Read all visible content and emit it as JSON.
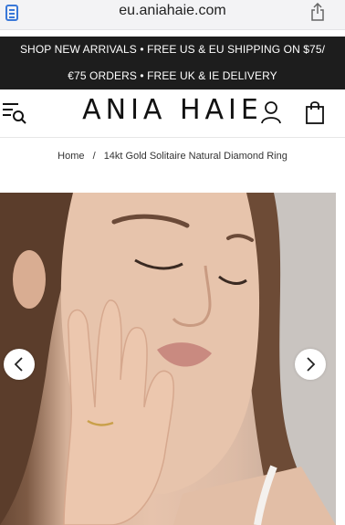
{
  "browser": {
    "url": "eu.aniahaie.com",
    "icons": {
      "reader": "reader-view-icon",
      "share": "share-icon"
    }
  },
  "announcement": {
    "line1": "SHOP NEW ARRIVALS • FREE US & EU SHIPPING ON $75/",
    "line2": "€75 ORDERS • FREE UK & IE DELIVERY"
  },
  "header": {
    "logo": "ANIA HAIE",
    "icons": {
      "menu": "menu-search-icon",
      "account": "account-icon",
      "cart": "bag-icon"
    }
  },
  "breadcrumb": {
    "home": "Home",
    "separator": "/",
    "current": "14kt Gold Solitaire Natural Diamond Ring"
  },
  "gallery": {
    "icons": {
      "prev": "chevron-left-icon",
      "next": "chevron-right-icon"
    }
  },
  "colors": {
    "announcement_bg": "#1d1d1d",
    "accent": "#3a78d8"
  }
}
